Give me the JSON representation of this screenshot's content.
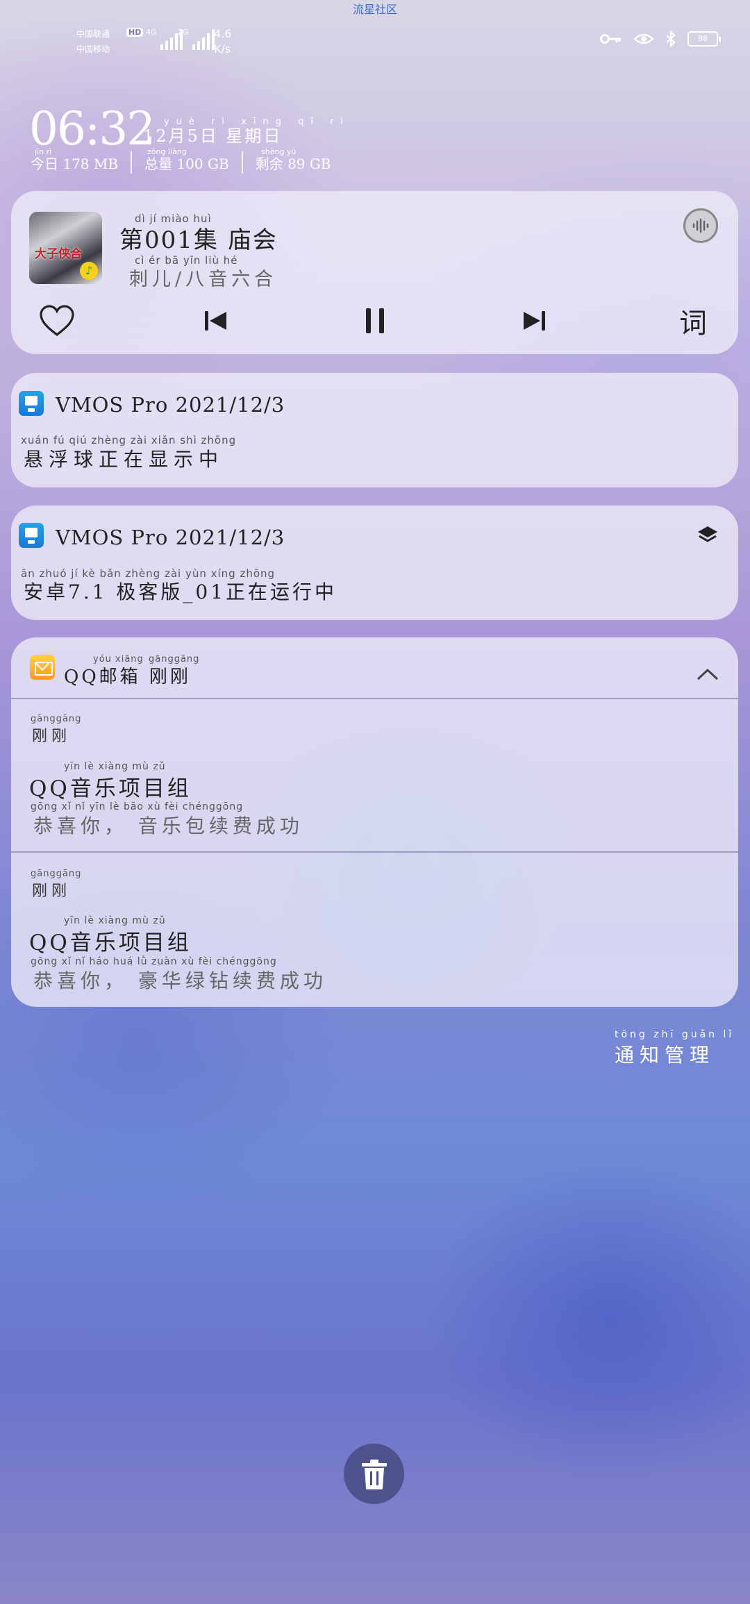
{
  "status_bar": {
    "watermark": "流星社区",
    "carrier_1": "中国联通",
    "carrier_2": "中国移动",
    "hd_badge": "HD",
    "net_1": "4G",
    "net_2": "2G",
    "speed_value": "4.6",
    "speed_unit": "K/s",
    "battery": "98",
    "icons": [
      "key-icon",
      "eye-icon",
      "bluetooth-icon",
      "battery-icon"
    ]
  },
  "lockscreen": {
    "time": "06:32",
    "date": "12月5日 星期日",
    "date_pinyin": "yuè rì xīng qī rì",
    "storage_today_label": "今日",
    "storage_today_py": "jīn rì",
    "storage_today_value": "178 MB",
    "storage_total_label": "总量",
    "storage_total_py": "zǒng liàng",
    "storage_total_value": "100 GB",
    "storage_left_label": "剩余",
    "storage_left_py": "shèng yú",
    "storage_left_value": "89 GB"
  },
  "music": {
    "title": "第001集 庙会",
    "title_pinyin": "dì       jí   miào huì",
    "artist": "刺儿/八音六合",
    "artist_pinyin": "cì   ér     bā  yīn  liù   hé",
    "album_text": "大子侠合",
    "lyric_button": "词",
    "controls": [
      "like-icon",
      "previous-icon",
      "pause-icon",
      "next-icon"
    ]
  },
  "notifications": [
    {
      "app": "VMOS Pro",
      "date": "2021/12/3",
      "body": "悬浮球正在显示中",
      "body_pinyin": "xuán  fú   qiú zhèng zài  xiǎn  shì zhōng"
    },
    {
      "app": "VMOS Pro",
      "date": "2021/12/3",
      "body": "安卓7.1 极客版_01正在运行中",
      "body_pinyin": "ān  zhuó         jí   kè  bǎn        zhèng zài  yùn xíng zhōng"
    }
  ],
  "mail": {
    "app": "QQ邮箱",
    "app_pinyin": "yóu xiāng",
    "time_header": "刚刚",
    "time_header_pinyin": "gānggāng",
    "messages": [
      {
        "time": "刚刚",
        "time_pinyin": "gānggāng",
        "sender": "QQ音乐项目组",
        "sender_pinyin": "yīn   lè  xiàng mù   zǔ",
        "text": "恭喜你， 音乐包续费成功",
        "text_pinyin": "gōng  xǐ   nǐ         yīn   lè  bāo   xù   fèi chénggōng"
      },
      {
        "time": "刚刚",
        "time_pinyin": "gānggāng",
        "sender": "QQ音乐项目组",
        "sender_pinyin": "yīn   lè  xiàng mù   zǔ",
        "text": "恭喜你， 豪华绿钻续费成功",
        "text_pinyin": "gōng  xǐ   nǐ         háo  huá   lǜ  zuàn  xù   fèi chénggōng"
      }
    ]
  },
  "footer": {
    "manage": "通知管理",
    "manage_pinyin": "tōng zhī guǎn lǐ"
  }
}
